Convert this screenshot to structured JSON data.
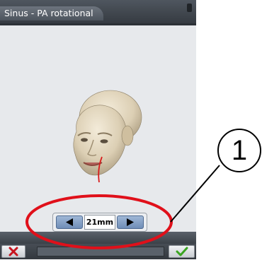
{
  "window": {
    "title": "Sinus - PA rotational"
  },
  "control": {
    "value": "21mm",
    "left_icon": "arrow-left-icon",
    "right_icon": "arrow-right-icon"
  },
  "bottom": {
    "cancel_icon": "cross-icon",
    "confirm_icon": "check-icon"
  },
  "annotation": {
    "number": "1"
  },
  "colors": {
    "highlight_ellipse": "#e0101a",
    "cancel_cross": "#c8141e",
    "confirm_check": "#3aa520",
    "titlebar": "#4f565f"
  }
}
